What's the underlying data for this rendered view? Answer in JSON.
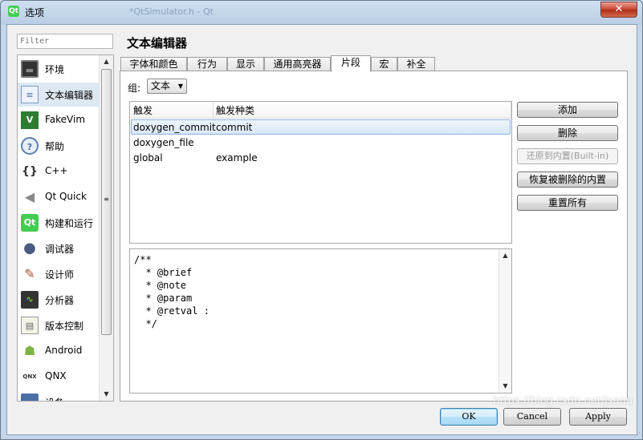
{
  "window": {
    "title": "选项",
    "app_icon_text": "Qt",
    "ghost_title": "*QtSimulator.h - Qt",
    "close_glyph": "✕"
  },
  "filter": {
    "placeholder": "Filter"
  },
  "nav": {
    "items": [
      {
        "label": "环境",
        "icon": "monitor-icon",
        "glyph": "▬",
        "selected": false
      },
      {
        "label": "文本编辑器",
        "icon": "text-editor-icon",
        "glyph": "≡",
        "selected": true
      },
      {
        "label": "FakeVim",
        "icon": "fakevim-icon",
        "glyph": "V",
        "selected": false
      },
      {
        "label": "帮助",
        "icon": "help-icon",
        "glyph": "?",
        "selected": false
      },
      {
        "label": "C++",
        "icon": "cpp-braces-icon",
        "glyph": "{}",
        "selected": false
      },
      {
        "label": "Qt Quick",
        "icon": "qt-quick-icon",
        "glyph": "◀",
        "selected": false
      },
      {
        "label": "构建和运行",
        "icon": "build-run-icon",
        "glyph": "Qt",
        "selected": false
      },
      {
        "label": "调试器",
        "icon": "debugger-icon",
        "glyph": "●",
        "selected": false
      },
      {
        "label": "设计师",
        "icon": "designer-icon",
        "glyph": "✎",
        "selected": false
      },
      {
        "label": "分析器",
        "icon": "analyzer-icon",
        "glyph": "∿",
        "selected": false
      },
      {
        "label": "版本控制",
        "icon": "version-control-icon",
        "glyph": "▤",
        "selected": false
      },
      {
        "label": "Android",
        "icon": "android-icon",
        "glyph": "☗",
        "selected": false
      },
      {
        "label": "QNX",
        "icon": "qnx-icon",
        "glyph": "QNX",
        "selected": false
      },
      {
        "label": "设备",
        "icon": "device-icon",
        "glyph": "▭",
        "selected": false
      }
    ],
    "scroll_up": "▲",
    "scroll_down": "▼",
    "scroll_grip": "≡"
  },
  "page": {
    "title": "文本编辑器"
  },
  "tabs": [
    {
      "label": "字体和颜色",
      "active": false
    },
    {
      "label": "行为",
      "active": false
    },
    {
      "label": "显示",
      "active": false
    },
    {
      "label": "通用高亮器",
      "active": false
    },
    {
      "label": "片段",
      "active": true
    },
    {
      "label": "宏",
      "active": false
    },
    {
      "label": "补全",
      "active": false
    }
  ],
  "snippets": {
    "group_label": "组:",
    "group_value": "文本",
    "dropdown_glyph": "▼",
    "columns": [
      "触发",
      "触发种类"
    ],
    "rows": [
      {
        "trigger": "doxygen_commit",
        "kind": "commit",
        "selected": true
      },
      {
        "trigger": "doxygen_file",
        "kind": "",
        "selected": false
      },
      {
        "trigger": "global",
        "kind": "example",
        "selected": false
      }
    ],
    "buttons": {
      "add": "添加",
      "remove": "删除",
      "revert_builtin": "还原到内置(Built-in)",
      "restore_removed": "恢复被删除的内置",
      "reset_all": "重置所有"
    },
    "editor_lines": [
      "/**",
      "  * @brief",
      "  * @note",
      "  * @param",
      "  * @retval :",
      "  */"
    ],
    "editor_scroll_up": "▲",
    "editor_scroll_down": "▼"
  },
  "footer": {
    "ok": "OK",
    "cancel": "Cancel",
    "apply": "Apply",
    "watermark": "https://blog.csdn.net/jsanu",
    "grip": "⋰"
  }
}
